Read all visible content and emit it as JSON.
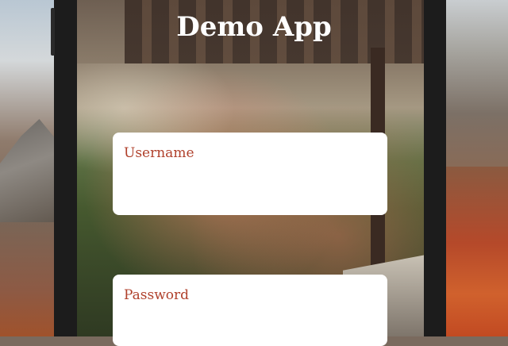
{
  "app": {
    "title": "Demo App"
  },
  "form": {
    "username": {
      "label": "Username",
      "value": "",
      "placeholder": ""
    },
    "password": {
      "label": "Password",
      "value": "",
      "placeholder": ""
    }
  },
  "colors": {
    "title": "#ffffff",
    "field_label": "#b0412c",
    "field_background": "#ffffff",
    "device_frame": "#1c1c1c"
  }
}
